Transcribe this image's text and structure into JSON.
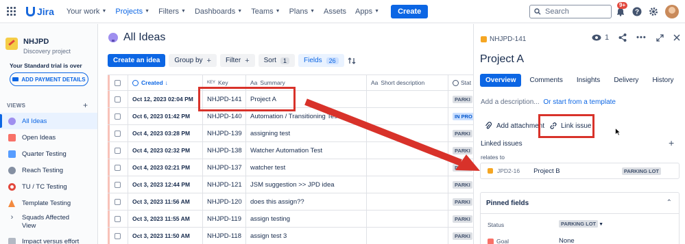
{
  "topnav": {
    "logo": "Jira",
    "items": [
      "Your work",
      "Projects",
      "Filters",
      "Dashboards",
      "Teams",
      "Plans",
      "Assets",
      "Apps"
    ],
    "create_label": "Create",
    "search_placeholder": "Search",
    "notification_count": "9+"
  },
  "sidebar": {
    "project_name": "NHJPD",
    "project_type": "Discovery project",
    "trial_text": "Your Standard trial is over",
    "payment_button": "ADD PAYMENT DETAILS",
    "views_label": "VIEWS",
    "items": [
      {
        "label": "All Ideas",
        "icon": "bulb-icon"
      },
      {
        "label": "Open Ideas",
        "icon": "sort-icon"
      },
      {
        "label": "Quarter Testing",
        "icon": "calendar-icon"
      },
      {
        "label": "Reach Testing",
        "icon": "satellite-icon"
      },
      {
        "label": "TU / TC Testing",
        "icon": "target-icon"
      },
      {
        "label": "Template Testing",
        "icon": "cone-icon"
      },
      {
        "label": "Squads Affected View",
        "icon": "chevron-right-icon"
      },
      {
        "label": "Impact versus effort",
        "icon": "chart-icon"
      }
    ]
  },
  "main": {
    "title": "All Ideas",
    "toolbar": {
      "create_idea": "Create an idea",
      "group_by": "Group by",
      "filter": "Filter",
      "sort": "Sort",
      "sort_count": "1",
      "fields": "Fields",
      "fields_count": "26"
    },
    "columns": [
      "Created",
      "Key",
      "Summary",
      "Short description",
      "Stat"
    ],
    "rows": [
      {
        "created": "Oct 12, 2023 02:04 PM",
        "key": "NHJPD-141",
        "summary": "Project A",
        "status": "PARKI"
      },
      {
        "created": "Oct 6, 2023 01:42 PM",
        "key": "NHJPD-140",
        "summary": "Automation / Transitioning Testing",
        "status": "IN PRO"
      },
      {
        "created": "Oct 4, 2023 03:28 PM",
        "key": "NHJPD-139",
        "summary": "assigning test",
        "status": "PARKI"
      },
      {
        "created": "Oct 4, 2023 02:32 PM",
        "key": "NHJPD-138",
        "summary": "Watcher Automation Test",
        "status": "PARKI"
      },
      {
        "created": "Oct 4, 2023 02:21 PM",
        "key": "NHJPD-137",
        "summary": "watcher test",
        "status": "PARKI"
      },
      {
        "created": "Oct 3, 2023 12:44 PM",
        "key": "NHJPD-121",
        "summary": "JSM suggestion >> JPD idea",
        "status": "PARKI"
      },
      {
        "created": "Oct 3, 2023 11:56 AM",
        "key": "NHJPD-120",
        "summary": "does this assign??",
        "status": "PARKI"
      },
      {
        "created": "Oct 3, 2023 11:55 AM",
        "key": "NHJPD-119",
        "summary": "assign testing",
        "status": "PARKI"
      },
      {
        "created": "Oct 3, 2023 11:50 AM",
        "key": "NHJPD-118",
        "summary": "assign test 3",
        "status": "PARKI"
      }
    ]
  },
  "panel": {
    "issue_key": "NHJPD-141",
    "watch_count": "1",
    "title": "Project A",
    "tabs": [
      "Overview",
      "Comments",
      "Insights",
      "Delivery",
      "History"
    ],
    "desc_placeholder": "Add a description...",
    "desc_or": "Or start from a template",
    "add_attachment": "Add attachment",
    "link_issue": "Link issue",
    "linked_issues_title": "Linked issues",
    "relates_to": "relates to",
    "linked": {
      "key": "JPD2-16",
      "summary": "Project B",
      "status": "PARKING LOT"
    },
    "pinned_title": "Pinned fields",
    "fields": [
      {
        "label": "Status",
        "value": "PARKING LOT"
      },
      {
        "label": "Goal",
        "value": "None"
      }
    ]
  },
  "colors": {
    "accent": "#0c66e4",
    "annotation": "#d8322a"
  }
}
